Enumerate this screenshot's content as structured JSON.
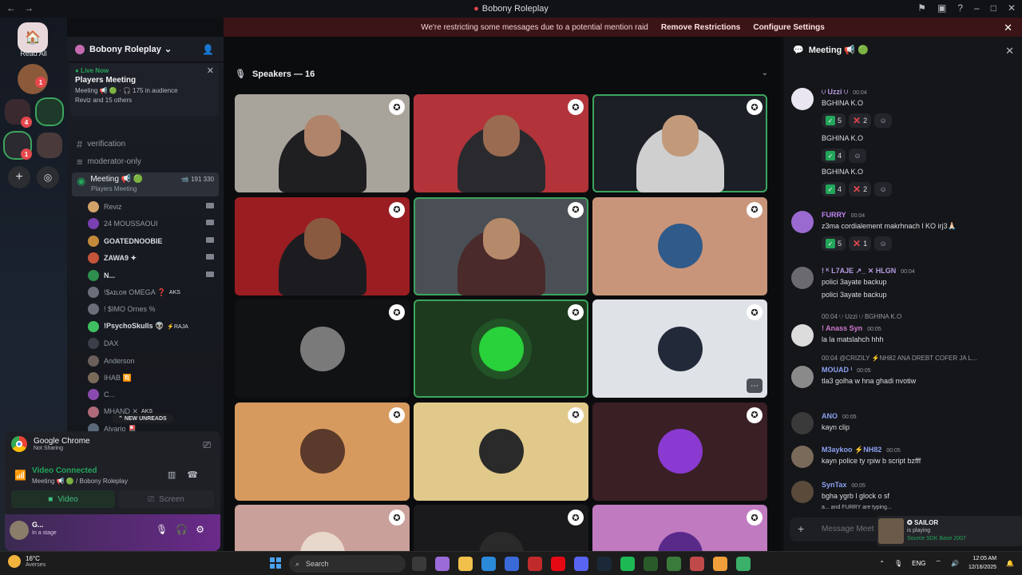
{
  "window": {
    "title": "Bobony Roleplay"
  },
  "banner": {
    "text": "We're restricting some messages due to a potential mention raid",
    "remove": "Remove Restrictions",
    "configure": "Configure Settings"
  },
  "guilds": {
    "read_all": "Read All",
    "badges": [
      "1",
      "4",
      "1"
    ]
  },
  "server": {
    "name": "Bobony Roleplay"
  },
  "live": {
    "tag": "Live Now",
    "title": "Players Meeting",
    "info": "Meeting 📢 🟢 · 🎧 175 in audience",
    "people": "Reviz and 15 others"
  },
  "channels": [
    {
      "name": "verification"
    },
    {
      "name": "moderator-only"
    }
  ],
  "voice_channel": {
    "name": "Meeting 📢 🟢",
    "counts": "📹 191  330",
    "sub": "Players Meeting"
  },
  "members": [
    {
      "name": "Reviz",
      "color": "#d4a36a",
      "bold": false,
      "tag": ""
    },
    {
      "name": "24 MOUSSAOUI",
      "color": "#7a3fb0",
      "bold": false,
      "tag": ""
    },
    {
      "name": "GOATEDNOOBIE",
      "color": "#c28a3a",
      "bold": true,
      "tag": ""
    },
    {
      "name": "ZAWA9 ✦",
      "color": "#c4543a",
      "bold": true,
      "tag": ""
    },
    {
      "name": "N...",
      "color": "#2e8f4e",
      "bold": true,
      "tag": ""
    },
    {
      "name": "!$ᴀɪʟᴏʀ OMEGA ❓",
      "color": "#6a6f7a",
      "bold": false,
      "tag": "AKS"
    },
    {
      "name": "! $IMO Ornes %",
      "color": "#6a6f7a",
      "bold": false,
      "tag": ""
    },
    {
      "name": "!PsychoSkulls 👽",
      "color": "#3fbf5f",
      "bold": true,
      "tag": "⚡RAJA"
    },
    {
      "name": "DAX",
      "color": "#3a3f4a",
      "bold": false,
      "tag": ""
    },
    {
      "name": "Anderson",
      "color": "#6a5f5a",
      "bold": false,
      "tag": ""
    },
    {
      "name": "IHAB 🈶",
      "color": "#7a6a5a",
      "bold": false,
      "tag": ""
    },
    {
      "name": "C...",
      "color": "#8a4ab0",
      "bold": false,
      "tag": ""
    },
    {
      "name": "MHAND ✕",
      "color": "#b06a7a",
      "bold": false,
      "tag": "AKS"
    },
    {
      "name": "Alvario 🎴",
      "color": "#5a6a7a",
      "bold": false,
      "tag": ""
    }
  ],
  "new_unreads": "NEW UNREADS",
  "screen_share": {
    "app": "Google Chrome",
    "status": "Not Sharing"
  },
  "voice": {
    "status": "Video Connected",
    "location": "Meeting 📢 🟢 / Bobony Roleplay",
    "video_btn": "Video",
    "screen_btn": "Screen"
  },
  "self_user": {
    "name": "G...",
    "status": "In a stage"
  },
  "stage": {
    "speakers_label": "Speakers — 16"
  },
  "tiles": [
    {
      "kind": "video",
      "bg": "#a8a49c",
      "body": "#1f1f22",
      "head": "#b0846a",
      "speaking": false
    },
    {
      "kind": "video",
      "bg": "#b2343a",
      "body": "#2a2a2e",
      "head": "#9a6b50",
      "speaking": false
    },
    {
      "kind": "video",
      "bg": "#1c1f26",
      "body": "#cfcfcf",
      "head": "#c29a7a",
      "speaking": true
    },
    {
      "kind": "video",
      "bg": "#9a1d22",
      "body": "#1c1c20",
      "head": "#8a5a40",
      "speaking": false
    },
    {
      "kind": "video",
      "bg": "#4a4f55",
      "body": "#4a2a2a",
      "head": "#b58a6a",
      "speaking": true
    },
    {
      "kind": "avatar",
      "bg": "#c9957a",
      "avatar": "#2f5a8a",
      "speaking": false
    },
    {
      "kind": "avatar",
      "bg": "#111214",
      "avatar": "#7a7a7a",
      "speaking": false
    },
    {
      "kind": "avatar",
      "bg": "#1d3a1f",
      "avatar": "#29d13a",
      "speaking": true
    },
    {
      "kind": "avatar",
      "bg": "#dfe3e8",
      "avatar": "#222a3a",
      "speaking": false
    },
    {
      "kind": "avatar",
      "bg": "#d79a5e",
      "avatar": "#5a3a2a",
      "speaking": false
    },
    {
      "kind": "avatar",
      "bg": "#e0c98a",
      "avatar": "#2a2a2a",
      "speaking": false
    },
    {
      "kind": "avatar",
      "bg": "#3a1f25",
      "avatar": "#8a3ad0",
      "speaking": false
    },
    {
      "kind": "avatar",
      "bg": "#caa09a",
      "avatar": "#e8d8cc",
      "speaking": false
    },
    {
      "kind": "avatar",
      "bg": "#1a1a1c",
      "avatar": "#2a2a2a",
      "speaking": false
    },
    {
      "kind": "avatar",
      "bg": "#c07ac0",
      "avatar": "#5a2a8a",
      "speaking": false
    }
  ],
  "chat": {
    "title": "Meeting 📢 🟢",
    "messages": [
      {
        "name": "ᵎ.ᵎ Uzzi ᵎ.ᵎ",
        "name_color": "#b49be0",
        "time": "00:04",
        "av": "#e9e6f2",
        "lines": [
          "BGHINA K.O"
        ],
        "reactions": [
          [
            "✓",
            "5"
          ],
          [
            "✕",
            "2"
          ]
        ]
      },
      {
        "name": "",
        "lines": [
          "BGHINA K.O"
        ],
        "reactions": [
          [
            "✓",
            "4"
          ]
        ]
      },
      {
        "name": "",
        "lines": [
          "BGHINA K.O"
        ],
        "reactions": [
          [
            "✓",
            "4"
          ],
          [
            "✕",
            "2"
          ]
        ]
      },
      {
        "name": "FURRY",
        "name_color": "#c084f0",
        "time": "00:04",
        "av": "#9a6ad0",
        "lines": [
          "z3ma cordialement makrhnach l KO irj3🙏🏻"
        ],
        "reactions": [
          [
            "✓",
            "5"
          ],
          [
            "✕",
            "1"
          ]
        ]
      },
      {
        "name": "! ᴷ L7AJE ↗_ ✕ HLGN",
        "name_color": "#b49be0",
        "time": "00:04",
        "av": "#6a6a70",
        "lines": [
          "polici 3ayate backup",
          "polici 3ayate backup"
        ],
        "reactions": []
      },
      {
        "name": "! Anass Syn",
        "name_color": "#d07ad0",
        "time": "00:05",
        "av": "#dcdcdc",
        "reply": "00:04 ᵎ.ᵎ Uzzi ᵎ.ᵎ BGHINA K.O",
        "lines": [
          "la la matslahch hhh"
        ],
        "reactions": []
      },
      {
        "name": "MOUAD ᴵ",
        "name_color": "#8aa0f0",
        "time": "00:05",
        "av": "#8a8a8a",
        "reply": "00:04 @CRIZILY ⚡NH82 ANA DREBT COFER JA L...",
        "lines": [
          "tla3 golha w hna ghadi nvotiw"
        ],
        "reactions": []
      },
      {
        "name": "ANO",
        "name_color": "#8aa0f0",
        "time": "00:05",
        "av": "#3a3a3a",
        "lines": [
          "kayn clip"
        ],
        "reactions": []
      },
      {
        "name": "M3aykoo ⚡NH82",
        "name_color": "#8aa0f0",
        "time": "00:05",
        "av": "#7a6a5a",
        "lines": [
          "kayn police ty rpiw b script bzfff"
        ],
        "reactions": []
      },
      {
        "name": "SynTax",
        "name_color": "#8aa0f0",
        "time": "00:05",
        "av": "#5a4a3a",
        "lines": [
          "bgha ygrb l glock o sf"
        ],
        "reactions": []
      }
    ],
    "typing": "a... and FURRY are typing...",
    "placeholder": "Message Meet"
  },
  "toast": {
    "name": "SAILOR",
    "status": "is playing",
    "game": "Source SDK Base 2007"
  },
  "taskbar": {
    "temp": "16°C",
    "place": "Averses",
    "search": "Search",
    "lang": "ENG",
    "time": "12:05 AM",
    "date": "12/16/2025"
  }
}
